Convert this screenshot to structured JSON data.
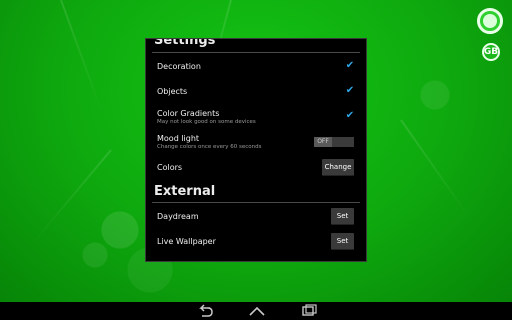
{
  "settings": {
    "section_title": "Settings",
    "rows": {
      "decoration": {
        "label": "Decoration",
        "checked": true
      },
      "objects": {
        "label": "Objects",
        "checked": true
      },
      "color_gradients": {
        "label": "Color Gradients",
        "sub": "May not look good on some devices",
        "checked": true
      },
      "mood_light": {
        "label": "Mood light",
        "sub": "Change colors once every 60 seconds",
        "toggle": "OFF"
      },
      "colors": {
        "label": "Colors",
        "button": "Change"
      }
    }
  },
  "external": {
    "section_title": "External",
    "rows": {
      "daydream": {
        "label": "Daydream",
        "button": "Set"
      },
      "live_wallpaper": {
        "label": "Live Wallpaper",
        "button": "Set"
      }
    }
  },
  "wallpaper_buttons": {
    "small_label": "GB"
  },
  "colors": {
    "wallpaper": "#0ea80e",
    "accent": "#2da8e8",
    "dialog_bg": "#000000"
  },
  "icons": [
    "checkbox-checked-icon",
    "back-icon",
    "home-icon",
    "recents-icon"
  ]
}
